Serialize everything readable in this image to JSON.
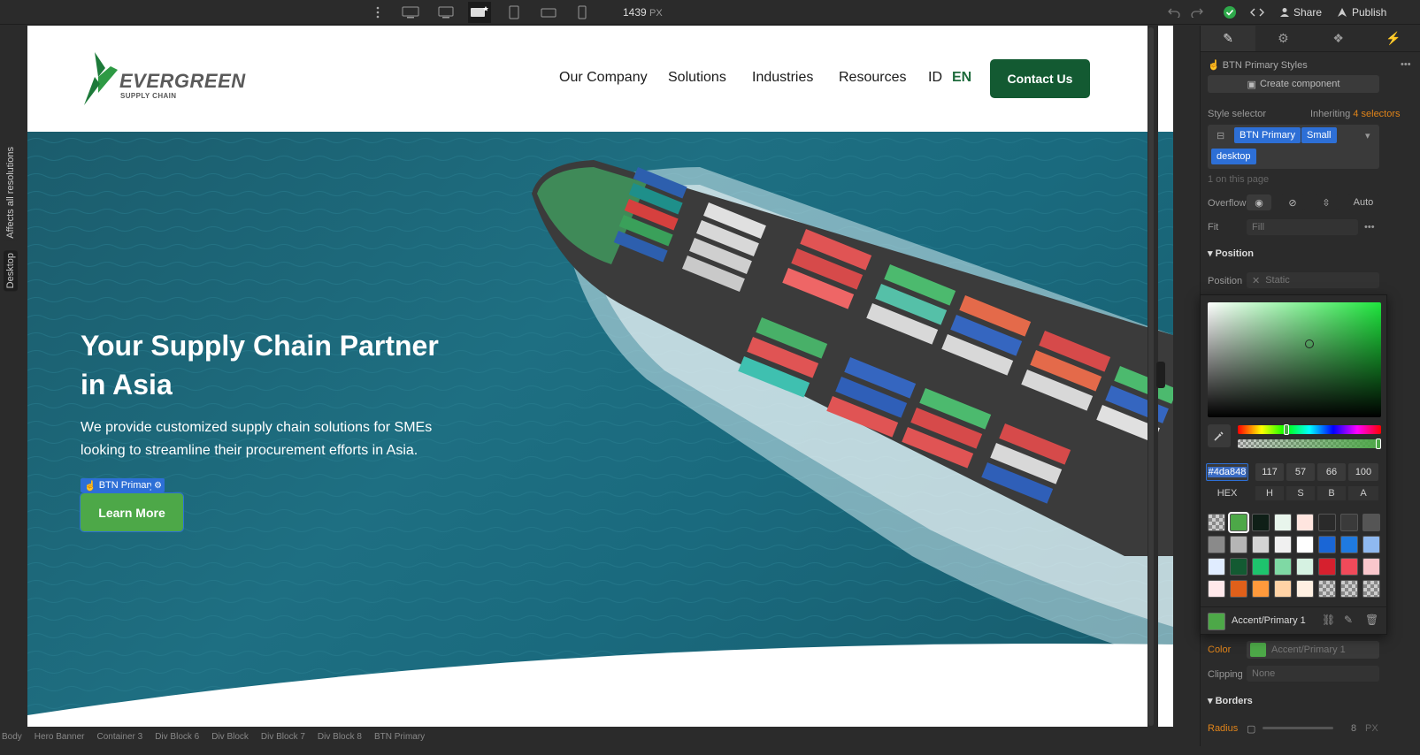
{
  "toolbar": {
    "width_value": "1439",
    "width_unit": "PX",
    "share_label": "Share",
    "publish_label": "Publish"
  },
  "side_labels": {
    "affects": "Affects all resolutions",
    "desktop": "Desktop"
  },
  "site": {
    "logo_brand_prefix": "EVER",
    "logo_brand_suffix": "GREEN",
    "logo_tagline": "SUPPLY CHAIN",
    "nav": [
      "Our Company",
      "Solutions",
      "Industries",
      "Resources"
    ],
    "lang_id": "ID",
    "lang_en": "EN",
    "contact_label": "Contact Us",
    "hero_title": "Your Supply Chain Partner in Asia",
    "hero_text": "We provide customized supply chain solutions for SMEs looking to streamline their procurement efforts in Asia.",
    "cta_label": "Learn More",
    "selection_tag": "BTN Primary"
  },
  "panel": {
    "style_name": "BTN Primary Styles",
    "create_component": "Create component",
    "style_selector_label": "Style selector",
    "inheriting_prefix": "Inheriting",
    "inheriting_count": "4 selectors",
    "chips": [
      "BTN Primary",
      "Small",
      "desktop"
    ],
    "on_page": "1 on this page",
    "overflow_label": "Overflow",
    "overflow_auto": "Auto",
    "fit_label": "Fit",
    "fit_value": "Fill",
    "position_section": "Position",
    "position_label": "Position",
    "position_value": "Static",
    "color_label": "Color",
    "color_value": "Accent/Primary 1",
    "clipping_label": "Clipping",
    "clipping_value": "None",
    "borders_section": "Borders",
    "radius_label": "Radius",
    "radius_value": "8",
    "radius_unit": "PX"
  },
  "picker": {
    "hex": "#4da848",
    "h": "117",
    "s": "57",
    "b": "66",
    "a": "100",
    "labels": [
      "HEX",
      "H",
      "S",
      "B",
      "A"
    ],
    "swatch_name": "Accent/Primary 1",
    "accent": "#4da848",
    "swatches": [
      "checker",
      "#4da848",
      "#0f1f17",
      "#e8f5ec",
      "#ffe5df",
      "#2a2a2a",
      "#3a3a3a",
      "#555555",
      "#8a8a8a",
      "#b5b5b5",
      "#d4d4d4",
      "#f0f0f0",
      "#ffffff",
      "#1a66d6",
      "#1f7ae0",
      "#8fb9f0",
      "#e0ecff",
      "#135a32",
      "#1ec36d",
      "#7fd9a4",
      "#d6f2e2",
      "#d6202e",
      "#f04a5a",
      "#f9c7cc",
      "#ffe8ea",
      "#e0601a",
      "#ff9a3c",
      "#ffd3a6",
      "#fff0e2",
      "checker",
      "checker",
      "checker"
    ]
  },
  "breadcrumbs": [
    "Body",
    "Hero Banner",
    "Container 3",
    "Div Block 6",
    "Div Block",
    "Div Block 7",
    "Div Block 8",
    "BTN Primary"
  ]
}
